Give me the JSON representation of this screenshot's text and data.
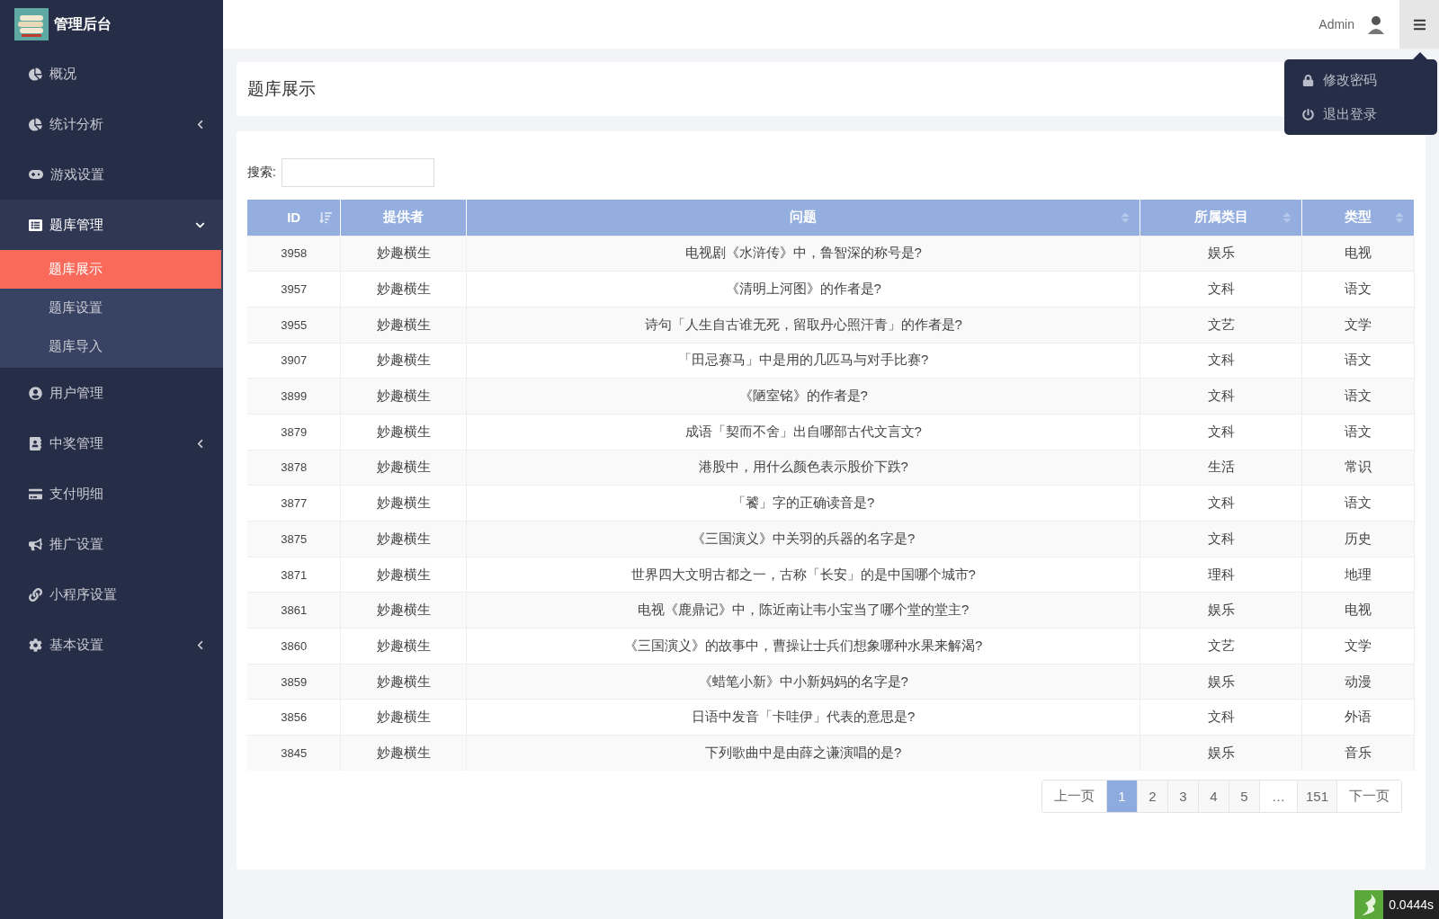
{
  "sidebar": {
    "brand": "管理后台",
    "items": [
      {
        "kind": "link",
        "label": "概况",
        "expanded": false
      },
      {
        "kind": "group",
        "label": "统计分析",
        "expanded": false
      },
      {
        "kind": "link",
        "label": "游戏设置",
        "expanded": false
      },
      {
        "kind": "group",
        "label": "题库管理",
        "expanded": true,
        "children": [
          {
            "label": "题库展示",
            "selected": true
          },
          {
            "label": "题库设置",
            "selected": false
          },
          {
            "label": "题库导入",
            "selected": false
          }
        ]
      },
      {
        "kind": "link",
        "label": "用户管理",
        "expanded": false
      },
      {
        "kind": "group",
        "label": "中奖管理",
        "expanded": false
      },
      {
        "kind": "link",
        "label": "支付明细",
        "expanded": false
      },
      {
        "kind": "link",
        "label": "推广设置",
        "expanded": false
      },
      {
        "kind": "link",
        "label": "小程序设置",
        "expanded": false
      },
      {
        "kind": "group",
        "label": "基本设置",
        "expanded": false
      }
    ]
  },
  "header": {
    "user": "Admin",
    "menu_open": true,
    "menu": [
      {
        "label": "修改密码"
      },
      {
        "label": "退出登录"
      }
    ]
  },
  "page_title": "题库展示",
  "search": {
    "label": "搜索:"
  },
  "table": {
    "columns": [
      {
        "label": "ID",
        "sortable": true,
        "sorted": true
      },
      {
        "label": "提供者",
        "sortable": false
      },
      {
        "label": "问题",
        "sortable": true,
        "sorted": false
      },
      {
        "label": "所属类目",
        "sortable": true,
        "sorted": false
      },
      {
        "label": "类型",
        "sortable": true,
        "sorted": false
      }
    ],
    "rows": [
      [
        "3958",
        "妙趣横生",
        "电视剧《水浒传》中，鲁智深的称号是?",
        "娱乐",
        "电视"
      ],
      [
        "3957",
        "妙趣横生",
        "《清明上河图》的作者是?",
        "文科",
        "语文"
      ],
      [
        "3955",
        "妙趣横生",
        "诗句「人生自古谁无死，留取丹心照汗青」的作者是?",
        "文艺",
        "文学"
      ],
      [
        "3907",
        "妙趣横生",
        "「田忌赛马」中是用的几匹马与对手比赛?",
        "文科",
        "语文"
      ],
      [
        "3899",
        "妙趣横生",
        "《陋室铭》的作者是?",
        "文科",
        "语文"
      ],
      [
        "3879",
        "妙趣横生",
        "成语「契而不舍」出自哪部古代文言文?",
        "文科",
        "语文"
      ],
      [
        "3878",
        "妙趣横生",
        "港股中，用什么颜色表示股价下跌?",
        "生活",
        "常识"
      ],
      [
        "3877",
        "妙趣横生",
        "「饕」字的正确读音是?",
        "文科",
        "语文"
      ],
      [
        "3875",
        "妙趣横生",
        "《三国演义》中关羽的兵器的名字是?",
        "文科",
        "历史"
      ],
      [
        "3871",
        "妙趣横生",
        "世界四大文明古都之一，古称「长安」的是中国哪个城市?",
        "理科",
        "地理"
      ],
      [
        "3861",
        "妙趣横生",
        "电视《鹿鼎记》中，陈近南让韦小宝当了哪个堂的堂主?",
        "娱乐",
        "电视"
      ],
      [
        "3860",
        "妙趣横生",
        "《三国演义》的故事中，曹操让士兵们想象哪种水果来解渴?",
        "文艺",
        "文学"
      ],
      [
        "3859",
        "妙趣横生",
        "《蜡笔小新》中小新妈妈的名字是?",
        "娱乐",
        "动漫"
      ],
      [
        "3856",
        "妙趣横生",
        "日语中发音「卡哇伊」代表的意思是?",
        "文科",
        "外语"
      ],
      [
        "3845",
        "妙趣横生",
        "下列歌曲中是由薛之谦演唱的是?",
        "娱乐",
        "音乐"
      ]
    ]
  },
  "pagination": [
    {
      "kind": "prev",
      "label": "上一页",
      "selected": false
    },
    {
      "kind": "page",
      "label": "1",
      "selected": true
    },
    {
      "kind": "page",
      "label": "2",
      "selected": false
    },
    {
      "kind": "page",
      "label": "3",
      "selected": false
    },
    {
      "kind": "page",
      "label": "4",
      "selected": false
    },
    {
      "kind": "page",
      "label": "5",
      "selected": false
    },
    {
      "kind": "ellipsis",
      "label": "…",
      "selected": false
    },
    {
      "kind": "page",
      "label": "151",
      "selected": false
    },
    {
      "kind": "next",
      "label": "下一页",
      "selected": false
    }
  ],
  "trace_badge": {
    "time": "0.0444s"
  }
}
